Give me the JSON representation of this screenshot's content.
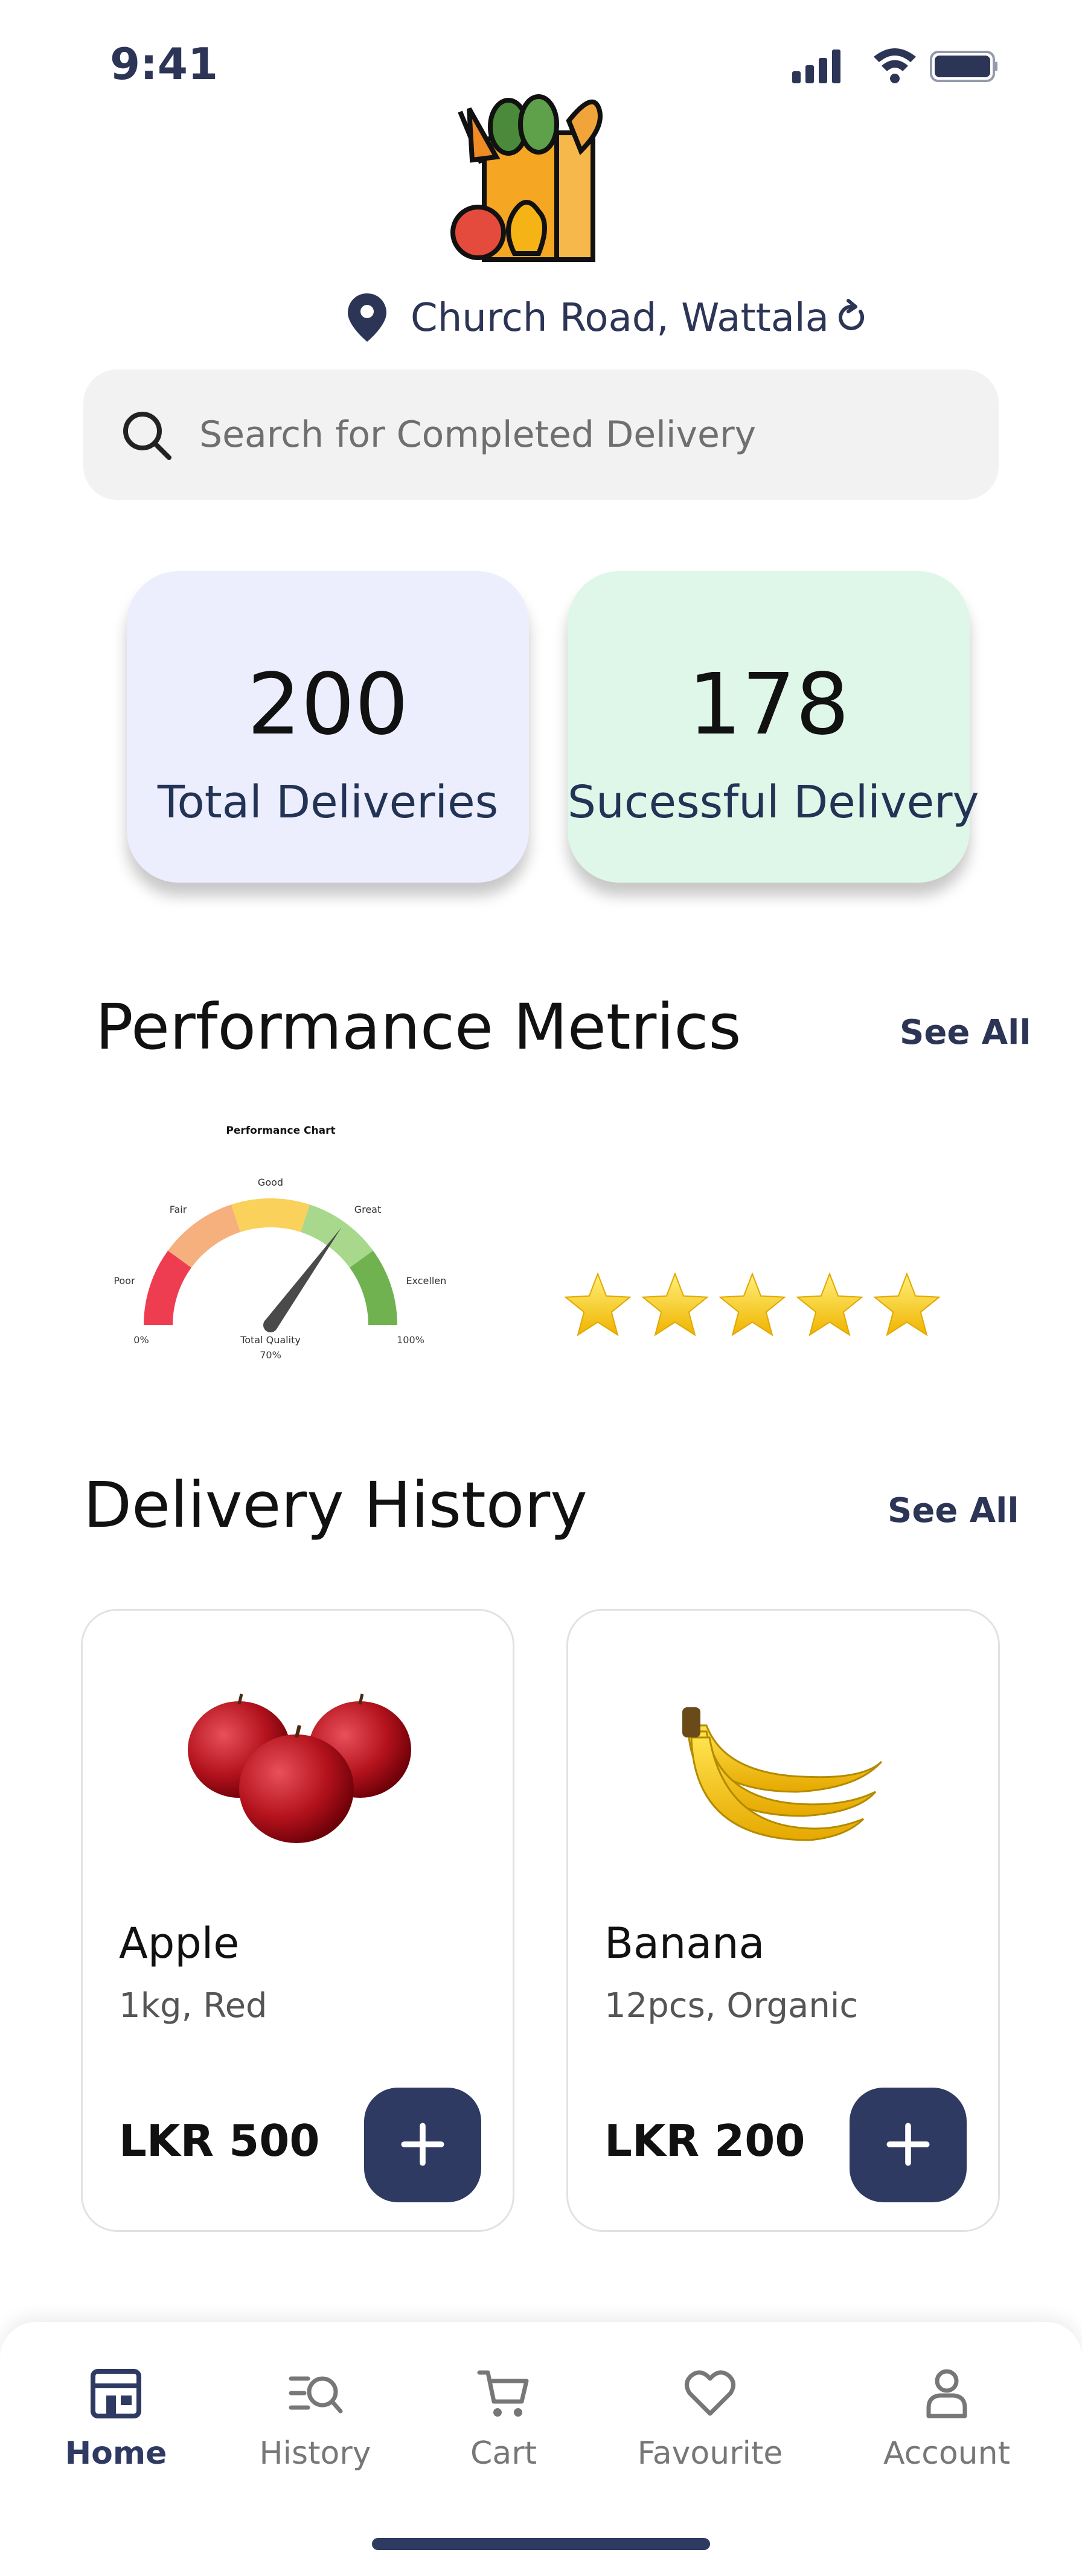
{
  "status_bar": {
    "time": "9:41"
  },
  "location": {
    "text": "Church Road, Wattala"
  },
  "search": {
    "placeholder": "Search for Completed Delivery"
  },
  "stats": [
    {
      "value": "200",
      "label": "Total Deliveries",
      "color": "#eceefd"
    },
    {
      "value": "178",
      "label": "Sucessful Delivery",
      "color": "#dff7e8"
    }
  ],
  "performance": {
    "title": "Performance Metrics",
    "see_all": "See All",
    "rating_stars": 5
  },
  "chart_data": {
    "type": "gauge",
    "title": "Performance Chart",
    "bands": [
      "Poor",
      "Fair",
      "Good",
      "Great",
      "Excellent"
    ],
    "band_colors": [
      "#ee3d50",
      "#f5b07d",
      "#fad15a",
      "#a8d88b",
      "#6fb24f"
    ],
    "min_label": "0%",
    "max_label": "100%",
    "center_label": "Total Quality",
    "value": 70,
    "value_label": "70%"
  },
  "history": {
    "title": "Delivery History",
    "see_all": "See All",
    "items": [
      {
        "name": "Apple",
        "desc": "1kg, Red",
        "price": "LKR 500"
      },
      {
        "name": "Banana",
        "desc": "12pcs, Organic",
        "price": "LKR 200"
      }
    ]
  },
  "nav": {
    "items": [
      {
        "label": "Home",
        "icon": "store-icon",
        "active": true
      },
      {
        "label": "History",
        "icon": "history-search-icon"
      },
      {
        "label": "Cart",
        "icon": "cart-icon"
      },
      {
        "label": "Favourite",
        "icon": "heart-icon"
      },
      {
        "label": "Account",
        "icon": "user-icon"
      }
    ]
  },
  "colors": {
    "primary": "#2f3a63",
    "text_dark": "#2c3556"
  }
}
